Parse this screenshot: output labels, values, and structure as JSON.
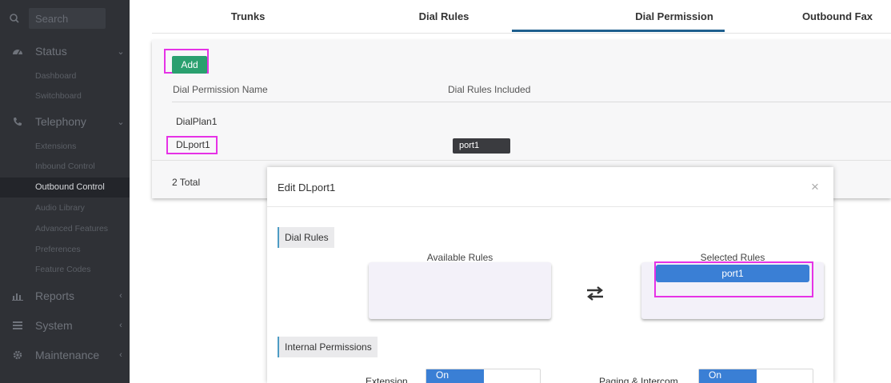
{
  "sidebar": {
    "search_placeholder": "Search",
    "groups": [
      {
        "label": "Status",
        "icon": "dashboard-icon"
      },
      {
        "label": "Telephony",
        "icon": "phone-icon"
      },
      {
        "label": "Reports",
        "icon": "bar-chart-icon"
      },
      {
        "label": "System",
        "icon": "list-icon"
      },
      {
        "label": "Maintenance",
        "icon": "gear-icon"
      }
    ],
    "status_items": [
      "Dashboard",
      "Switchboard"
    ],
    "telephony_items": [
      "Extensions",
      "Inbound Control",
      "Outbound Control",
      "Audio Library",
      "Advanced Features",
      "Preferences",
      "Feature Codes"
    ],
    "active_item": "Outbound Control"
  },
  "tabs": [
    "Trunks",
    "Dial Rules",
    "Dial Permission",
    "Outbound Fax"
  ],
  "active_tab": "Dial Permission",
  "card": {
    "add_label": "Add",
    "columns": [
      "Dial Permission Name",
      "Dial Rules Included"
    ],
    "rows": [
      {
        "name": "DialPlan1",
        "rules": ""
      },
      {
        "name": "DLport1",
        "rules": "port1"
      }
    ],
    "total": "2 Total"
  },
  "modal": {
    "title": "Edit DLport1",
    "close": "×",
    "dial_rules_section": "Dial Rules",
    "available_label": "Available Rules",
    "selected_label": "Selected Rules",
    "selected_rules": [
      "port1"
    ],
    "internal_section": "Internal Permissions",
    "permissions": [
      {
        "label": "Extension",
        "state": "On"
      },
      {
        "label": "Paging & Intercom",
        "state": "On"
      }
    ]
  },
  "colors": {
    "sidebar_bg": "#2f3136",
    "accent_green": "#2aa06f",
    "accent_blue": "#3a7fd5",
    "tab_underline": "#1e5f8e",
    "highlight": "#e632e6"
  }
}
